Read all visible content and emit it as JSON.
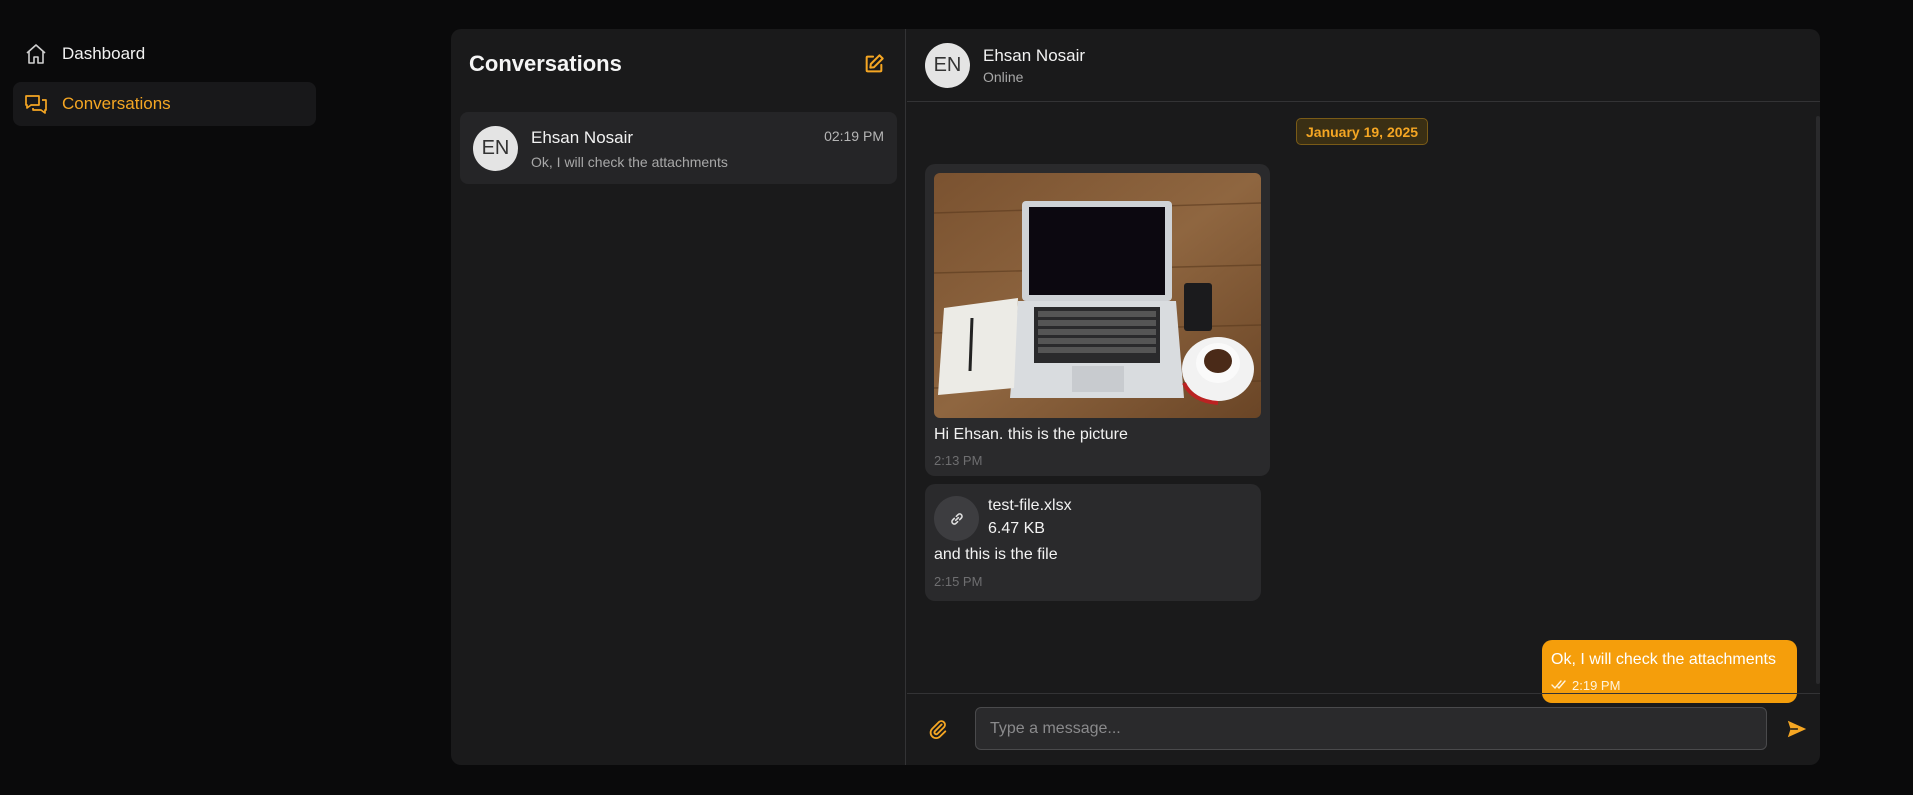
{
  "sidebar": {
    "items": [
      {
        "label": "Dashboard",
        "icon": "home-icon",
        "active": false
      },
      {
        "label": "Conversations",
        "icon": "chat-icon",
        "active": true
      }
    ]
  },
  "conversations": {
    "title": "Conversations",
    "compose_icon": "edit-icon",
    "items": [
      {
        "initials": "EN",
        "name": "Ehsan Nosair",
        "preview": "Ok, I will check the attachments",
        "time": "02:19 PM"
      }
    ]
  },
  "chat": {
    "initials": "EN",
    "name": "Ehsan Nosair",
    "status": "Online",
    "date": "January 19, 2025",
    "messages": [
      {
        "type": "image",
        "image_icon": "laptop-photo",
        "text": "Hi Ehsan. this is the picture",
        "time": "2:13 PM"
      },
      {
        "type": "file",
        "file_icon": "link-icon",
        "file_name": "test-file.xlsx",
        "file_size": "6.47 KB",
        "text": "and this is the file",
        "time": "2:15 PM"
      },
      {
        "type": "sent",
        "text": "Ok, I will check the attachments",
        "time": "2:19 PM",
        "status_icon": "double-check-icon"
      }
    ],
    "composer": {
      "placeholder": "Type a message...",
      "attach_icon": "paperclip-icon",
      "send_icon": "send-icon"
    }
  },
  "colors": {
    "accent": "#f5a623",
    "sent_bubble": "#f59e0b",
    "panel": "#1a1a1b",
    "background": "#0a0a0b"
  }
}
